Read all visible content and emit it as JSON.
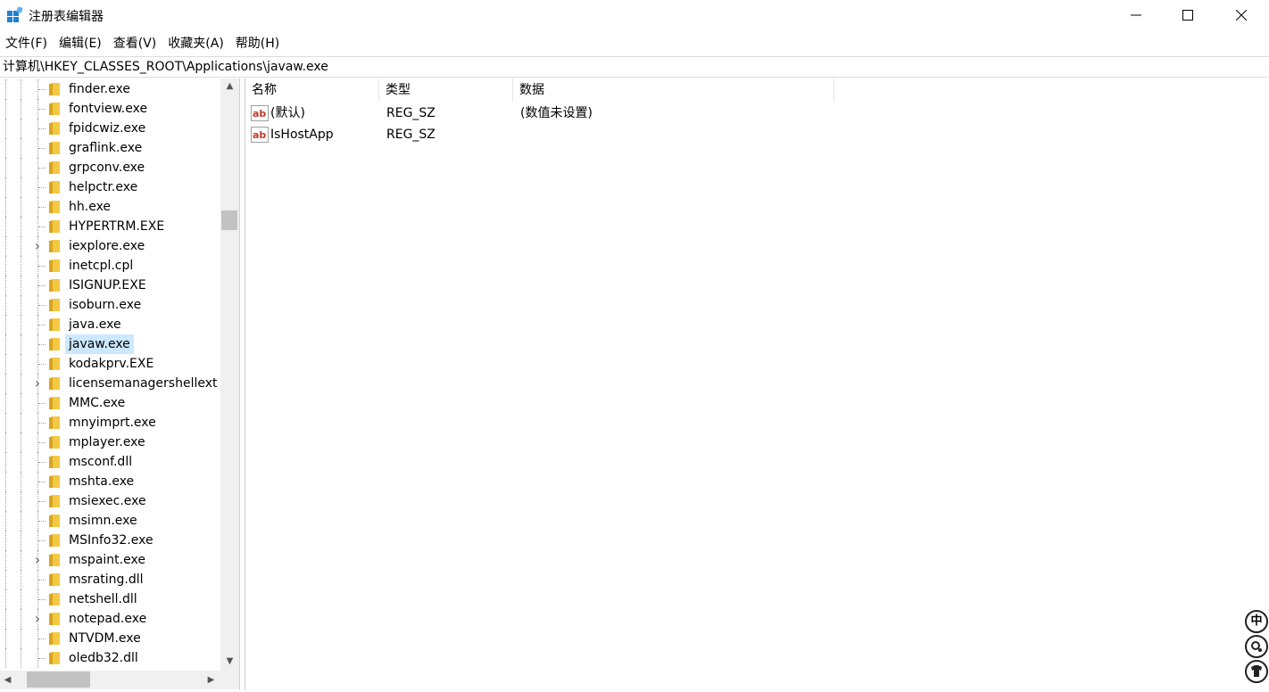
{
  "window": {
    "title": "注册表编辑器"
  },
  "menu": [
    "文件(F)",
    "编辑(E)",
    "查看(V)",
    "收藏夹(A)",
    "帮助(H)"
  ],
  "address": "计算机\\HKEY_CLASSES_ROOT\\Applications\\javaw.exe",
  "tree": {
    "items": [
      {
        "label": "finder.exe",
        "expandable": false
      },
      {
        "label": "fontview.exe",
        "expandable": false
      },
      {
        "label": "fpidcwiz.exe",
        "expandable": false
      },
      {
        "label": "graflink.exe",
        "expandable": false
      },
      {
        "label": "grpconv.exe",
        "expandable": false
      },
      {
        "label": "helpctr.exe",
        "expandable": false
      },
      {
        "label": "hh.exe",
        "expandable": false
      },
      {
        "label": "HYPERTRM.EXE",
        "expandable": false
      },
      {
        "label": "iexplore.exe",
        "expandable": true
      },
      {
        "label": "inetcpl.cpl",
        "expandable": false
      },
      {
        "label": "ISIGNUP.EXE",
        "expandable": false
      },
      {
        "label": "isoburn.exe",
        "expandable": false
      },
      {
        "label": "java.exe",
        "expandable": false
      },
      {
        "label": "javaw.exe",
        "expandable": false,
        "selected": true
      },
      {
        "label": "kodakprv.EXE",
        "expandable": false
      },
      {
        "label": "licensemanagershellext",
        "expandable": true
      },
      {
        "label": "MMC.exe",
        "expandable": false
      },
      {
        "label": "mnyimprt.exe",
        "expandable": false
      },
      {
        "label": "mplayer.exe",
        "expandable": false
      },
      {
        "label": "msconf.dll",
        "expandable": false
      },
      {
        "label": "mshta.exe",
        "expandable": false
      },
      {
        "label": "msiexec.exe",
        "expandable": false
      },
      {
        "label": "msimn.exe",
        "expandable": false
      },
      {
        "label": "MSInfo32.exe",
        "expandable": false
      },
      {
        "label": "mspaint.exe",
        "expandable": true
      },
      {
        "label": "msrating.dll",
        "expandable": false
      },
      {
        "label": "netshell.dll",
        "expandable": false
      },
      {
        "label": "notepad.exe",
        "expandable": true
      },
      {
        "label": "NTVDM.exe",
        "expandable": false
      },
      {
        "label": "oledb32.dll",
        "expandable": false
      }
    ]
  },
  "list": {
    "columns": [
      "名称",
      "类型",
      "数据"
    ],
    "rows": [
      {
        "name": "(默认)",
        "type": "REG_SZ",
        "data": "(数值未设置)"
      },
      {
        "name": "IsHostApp",
        "type": "REG_SZ",
        "data": ""
      }
    ]
  },
  "ime": {
    "mode_label": "中"
  },
  "colors": {
    "selection": "#cce8ff",
    "folder": "#f3c843",
    "app_icon": "#1f7fd4"
  }
}
